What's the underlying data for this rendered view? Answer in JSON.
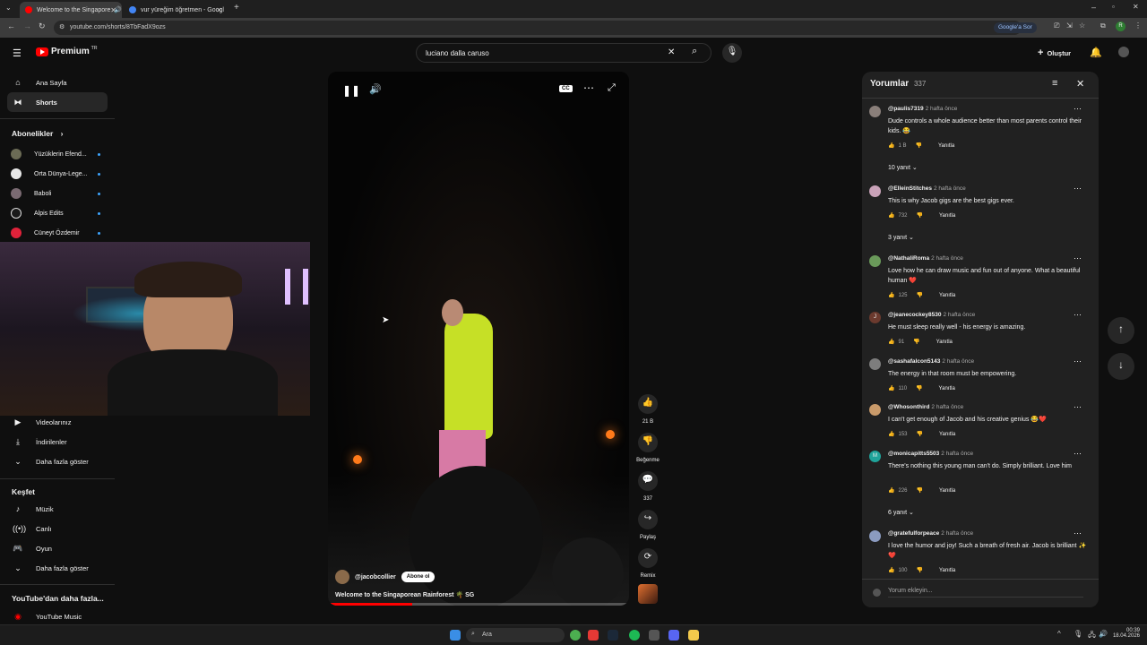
{
  "browser": {
    "tabs": [
      {
        "title": "Welcome to the Singapore"
      },
      {
        "title": "vur yüreğim öğretmen - Googl"
      }
    ],
    "url": "youtube.com/shorts/8TbFadX9ozs",
    "google_lens_label": "Google'a Sor"
  },
  "masthead": {
    "logo_text": "Premium",
    "country_code": "TR",
    "search_value": "luciano dalla caruso",
    "create_label": "Oluştur"
  },
  "sidebar": {
    "home": "Ana Sayfa",
    "shorts": "Shorts",
    "subscriptions_header": "Abonelikler",
    "subscriptions": [
      {
        "name": "Yüzüklerin Efend..."
      },
      {
        "name": "Orta Dünya-Lege..."
      },
      {
        "name": "Baboli"
      },
      {
        "name": "Alpis Edits"
      },
      {
        "name": "Cüneyt Özdemir"
      }
    ],
    "your_videos": "Videolarınız",
    "downloads": "İndirilenler",
    "show_more": "Daha fazla göster",
    "explore_header": "Keşfet",
    "explore": [
      {
        "label": "Müzik"
      },
      {
        "label": "Canlı"
      },
      {
        "label": "Oyun"
      }
    ],
    "explore_more": "Daha fazla göster",
    "more_from_header": "YouTube'dan daha fazla...",
    "youtube_music": "YouTube Music"
  },
  "player": {
    "channel": "@jacobcollier",
    "subscribe_label": "Abone ol",
    "title": "Welcome to the Singaporean Rainforest 🌴 SG",
    "cc_label": "CC",
    "progress": 0.28
  },
  "actions": {
    "likes": "21 B",
    "dislike_label": "Beğenme",
    "comments": "337",
    "share_label": "Paylaş",
    "remix_label": "Remix"
  },
  "comments_panel": {
    "title": "Yorumlar",
    "count": "337",
    "add_comment_placeholder": "Yorum ekleyin...",
    "reply_label": "Yanıtla",
    "items": [
      {
        "user": "@paulis7319",
        "time": "2 hafta önce",
        "text": "Dude controls a whole audience better than most parents control their kids. 😂",
        "likes": "1 B",
        "replies": "10 yanıt",
        "avatar_color": "#8a7f7a"
      },
      {
        "user": "@ElleinStitches",
        "time": "2 hafta önce",
        "text": "This is why Jacob gigs are the best gigs ever.",
        "likes": "732",
        "replies": "3 yanıt",
        "avatar_color": "#c9a2b8"
      },
      {
        "user": "@NathaliRoma",
        "time": "2 hafta önce",
        "text": "Love how he can draw music and fun out of anyone. What a beautiful human ❤️",
        "likes": "125",
        "replies": "",
        "avatar_color": "#6a9a5a"
      },
      {
        "user": "@jeanecockey8530",
        "time": "2 hafta önce",
        "text": "He must sleep really well - his energy is amazing.",
        "likes": "91",
        "replies": "",
        "avatar_color": "#6b3a2e",
        "avatar_letter": "J"
      },
      {
        "user": "@sashafalcon5143",
        "time": "2 hafta önce",
        "text": "The energy in that room must be empowering.",
        "likes": "110",
        "replies": "",
        "avatar_color": "#7d7d7d"
      },
      {
        "user": "@Whosonthird",
        "time": "2 hafta önce",
        "text": "I can't get enough of Jacob and his creative genius 😂❤️",
        "likes": "153",
        "replies": "",
        "avatar_color": "#c99a6a"
      },
      {
        "user": "@monicapitts5503",
        "time": "2 hafta önce",
        "text": "There's nothing this young man can't do. Simply brilliant. Love him",
        "likes": "226",
        "replies": "6 yanıt",
        "avatar_color": "#1fa39a",
        "avatar_letter": "M"
      },
      {
        "user": "@gratefulforpeace",
        "time": "2 hafta önce",
        "text": "I love the humor and joy! Such a breath of fresh air. Jacob is brilliant ✨❤️",
        "likes": "100",
        "replies": "",
        "avatar_color": "#8b9bc0"
      }
    ]
  },
  "taskbar": {
    "search_placeholder": "Ara",
    "time": "00:39",
    "date": "18.04.2026"
  }
}
